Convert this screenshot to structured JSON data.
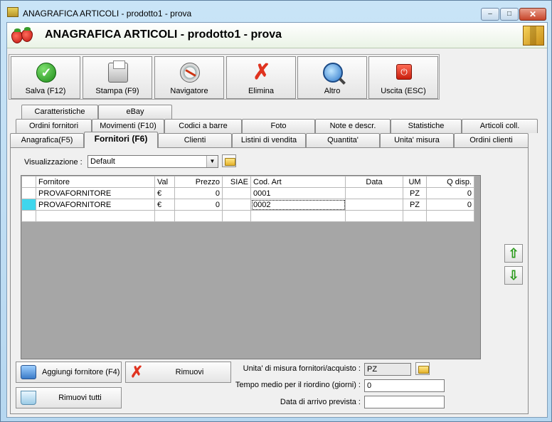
{
  "window": {
    "title": "ANAGRAFICA ARTICOLI - prodotto1 - prova",
    "header_title": "ANAGRAFICA ARTICOLI - prodotto1 - prova",
    "controls": {
      "minimize": "–",
      "maximize": "□",
      "close": "✕"
    }
  },
  "toolbar": {
    "buttons": [
      {
        "label": "Salva (F12)",
        "icon": "check-icon"
      },
      {
        "label": "Stampa (F9)",
        "icon": "printer-icon"
      },
      {
        "label": "Navigatore",
        "icon": "compass-icon"
      },
      {
        "label": "Elimina",
        "icon": "red-x-icon"
      },
      {
        "label": "Altro",
        "icon": "magnifier-icon"
      },
      {
        "label": "Uscita (ESC)",
        "icon": "power-icon"
      }
    ]
  },
  "tabs": {
    "row1": [
      "Caratteristiche",
      "eBay"
    ],
    "row2": [
      "Ordini fornitori",
      "Movimenti (F10)",
      "Codici a barre",
      "Foto",
      "Note e descr.",
      "Statistiche",
      "Articoli coll."
    ],
    "row3": [
      "Anagrafica(F5)",
      "Fornitori (F6)",
      "Clienti",
      "Listini di vendita",
      "Quantita'",
      "Unita' misura",
      "Ordini clienti"
    ],
    "active": "Fornitori (F6)"
  },
  "visualizzazione": {
    "label": "Visualizzazione :",
    "value": "Default"
  },
  "grid": {
    "columns": [
      "Fornitore",
      "Val",
      "Prezzo",
      "SIAE",
      "Cod. Art",
      "Data",
      "UM",
      "Q disp."
    ],
    "rows": [
      {
        "fornitore": "PROVAFORNITORE",
        "val": "€",
        "prezzo": "0",
        "siae": "",
        "cod_art": "0001",
        "data": "",
        "um": "PZ",
        "q_disp": "0"
      },
      {
        "fornitore": "PROVAFORNITORE",
        "val": "€",
        "prezzo": "0",
        "siae": "",
        "cod_art": "0002",
        "data": "",
        "um": "PZ",
        "q_disp": "0"
      }
    ],
    "selected_row": 1
  },
  "buttons": {
    "aggiungi": "Aggiungi fornitore (F4)",
    "rimuovi": "Rimuovi",
    "rimuovi_tutti": "Rimuovi tutti"
  },
  "form": {
    "um_label": "Unita' di misura fornitori/acquisto :",
    "um_value": "PZ",
    "tempo_label": "Tempo medio per il riordino (giorni) :",
    "tempo_value": "0",
    "data_label": "Data di arrivo prevista :",
    "data_value": ""
  },
  "colors": {
    "accent_selection": "#3fd6ec",
    "arrow_green": "#2a9a1a",
    "delete_red": "#e0331f"
  }
}
